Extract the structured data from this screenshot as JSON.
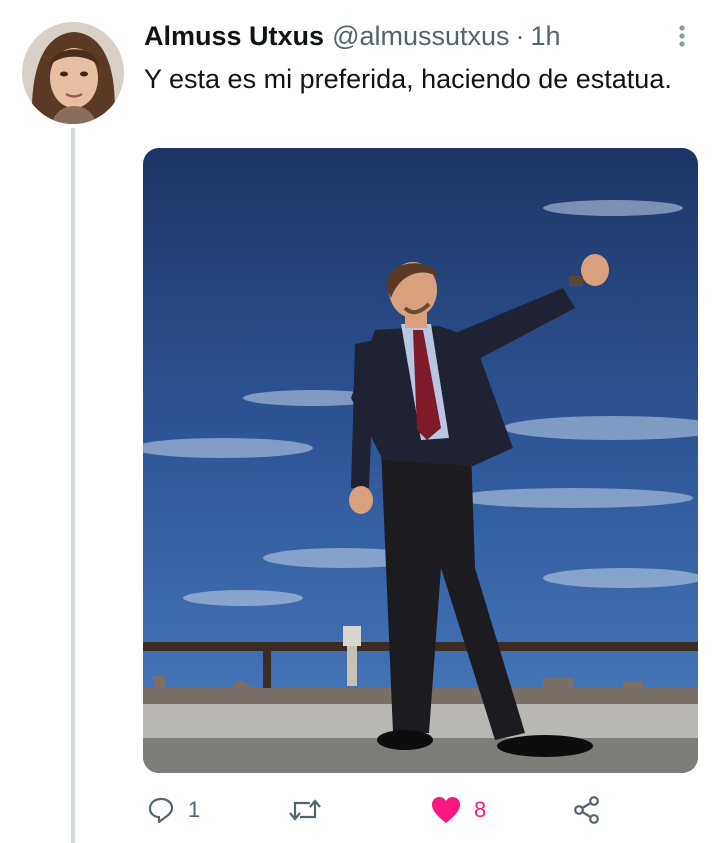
{
  "tweet": {
    "author_name": "Almuss Utxus",
    "handle": "@almussutxus",
    "separator": "·",
    "time": "1h",
    "text": "Y esta es mi preferida, haciendo de estatua."
  },
  "actions": {
    "reply_count": "1",
    "retweet_count": "",
    "like_count": "8"
  },
  "icons": {
    "reply": "reply-icon",
    "retweet": "retweet-icon",
    "like": "heart-filled-icon",
    "share": "share-icon",
    "more": "more-vertical-icon"
  },
  "colors": {
    "like_active": "#f91880",
    "secondary_text": "#536471",
    "thread_line": "#cfd9de"
  }
}
